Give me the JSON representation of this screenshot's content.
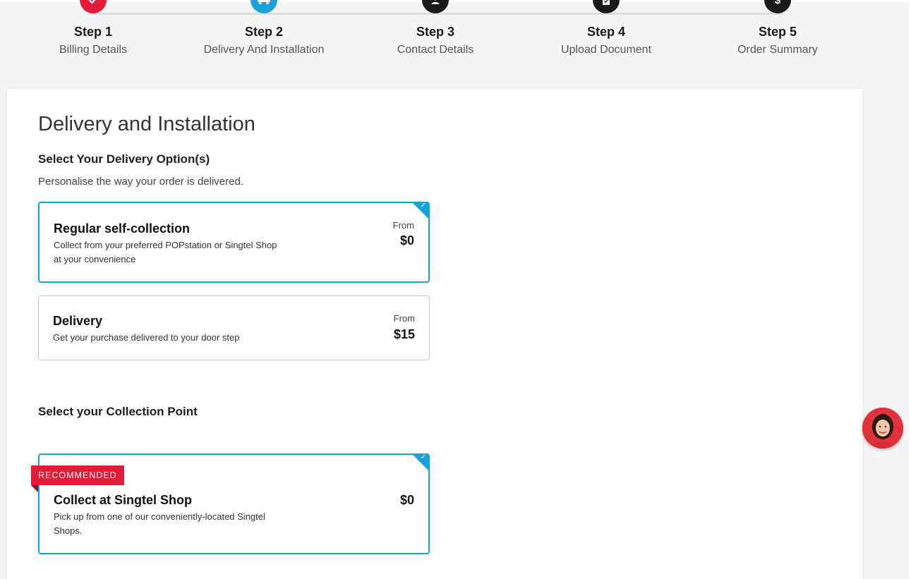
{
  "colors": {
    "completed": "#e21b36",
    "active": "#1aa1d9",
    "pending": "#1a1a1a",
    "selected_border": "#1aa1d9",
    "badge": "#e21b36"
  },
  "stepper": {
    "steps": [
      {
        "title": "Step 1",
        "subtitle": "Billing Details",
        "icon": "check-icon",
        "state": "completed"
      },
      {
        "title": "Step 2",
        "subtitle": "Delivery And Installation",
        "icon": "truck-icon",
        "state": "active"
      },
      {
        "title": "Step 3",
        "subtitle": "Contact Details",
        "icon": "user-icon",
        "state": "pending"
      },
      {
        "title": "Step 4",
        "subtitle": "Upload Document",
        "icon": "document-icon",
        "state": "pending"
      },
      {
        "title": "Step 5",
        "subtitle": "Order Summary",
        "icon": "dollar-icon",
        "state": "pending"
      }
    ]
  },
  "main": {
    "title": "Delivery and Installation",
    "delivery_section": {
      "heading": "Select Your Delivery Option(s)",
      "description": "Personalise the way your order is delivered.",
      "options": [
        {
          "title": "Regular self-collection",
          "description": "Collect from your preferred POPstation or Singtel Shop at your convenience",
          "price_prefix": "From",
          "price": "$0",
          "selected": true
        },
        {
          "title": "Delivery",
          "description": "Get your purchase delivered to your door step",
          "price_prefix": "From",
          "price": "$15",
          "selected": false
        }
      ]
    },
    "collection_section": {
      "heading": "Select your Collection Point",
      "options": [
        {
          "badge": "RECOMMENDED",
          "title": "Collect at Singtel Shop",
          "description": "Pick up from one of our conveniently-located Singtel Shops.",
          "price": "$0",
          "selected": true
        }
      ]
    }
  },
  "chat": {
    "icon": "chat-assistant-avatar"
  }
}
